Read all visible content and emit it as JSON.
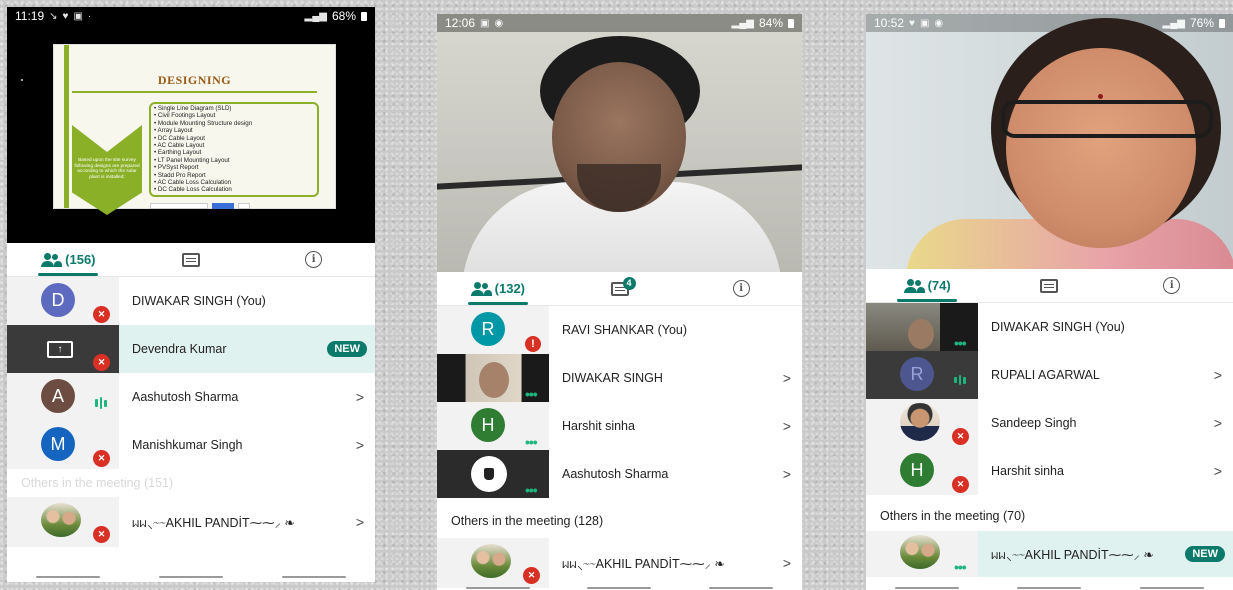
{
  "phone1": {
    "status": {
      "time": "11:19",
      "battery": "68%"
    },
    "slide": {
      "title": "DESIGNING",
      "bullets": [
        "Single Line Diagram (SLD)",
        "Civil Footings Layout",
        "Module Mounting Structure design",
        "Array Layout",
        "DC Cable Layout",
        "AC Cable Layout",
        "Earthing Layout",
        "LT Panel Mounting Layout",
        "PVSyst Report",
        "Stadd Pro Report",
        "AC Cable Loss Calculation",
        "DC Cable Loss Calculation"
      ],
      "chevron_text": "Based upon the site survey following designs are prepared according to which the solar plant is installed:"
    },
    "tabs": {
      "people_count": "(156)"
    },
    "participants": [
      {
        "initial": "D",
        "name": "DIWAKAR SINGH (You)",
        "color": "#5c6bc0"
      },
      {
        "name": "Devendra Kumar",
        "badge": "NEW"
      },
      {
        "initial": "A",
        "name": "Aashutosh Sharma",
        "color": "#6d4c41"
      },
      {
        "initial": "M",
        "name": "Manishkumar Singh",
        "color": "#1565c0"
      }
    ],
    "others_header": "Others in the meeting (151)",
    "others": [
      {
        "name": "ᥕᥕ⸜⁓⁓AKHIL PANDİT⁓⁓⸝ ❧"
      }
    ]
  },
  "phone2": {
    "status": {
      "time": "12:06",
      "battery": "84%"
    },
    "tabs": {
      "people_count": "(132)",
      "chat_badge": "4"
    },
    "participants": [
      {
        "initial": "R",
        "name": "RAVI SHANKAR (You)",
        "color": "#0097a7"
      },
      {
        "name": "DIWAKAR SINGH"
      },
      {
        "initial": "H",
        "name": "Harshit sinha",
        "color": "#2e7d32"
      },
      {
        "name": "Aashutosh Sharma"
      }
    ],
    "others_header": "Others in the meeting (128)",
    "others": [
      {
        "name": "ᥕᥕ⸜⁓⁓AKHIL PANDİT⁓⁓⸝ ❧"
      }
    ]
  },
  "phone3": {
    "status": {
      "time": "10:52",
      "battery": "76%"
    },
    "tabs": {
      "people_count": "(74)"
    },
    "participants": [
      {
        "name": "DIWAKAR SINGH (You)"
      },
      {
        "initial": "R",
        "name": "RUPALI AGARWAL",
        "color": "#5c6bc0"
      },
      {
        "name": "Sandeep Singh"
      },
      {
        "initial": "H",
        "name": "Harshit sinha",
        "color": "#2e7d32"
      }
    ],
    "others_header": "Others in the meeting (70)",
    "others": [
      {
        "name": "ᥕᥕ⸜⁓⁓AKHIL PANDİT⁓⁓⸝ ❧",
        "badge": "NEW"
      }
    ]
  },
  "colors": {
    "accent": "#0b7a6b",
    "mute": "#d93025",
    "speaking": "#1fb57f"
  }
}
